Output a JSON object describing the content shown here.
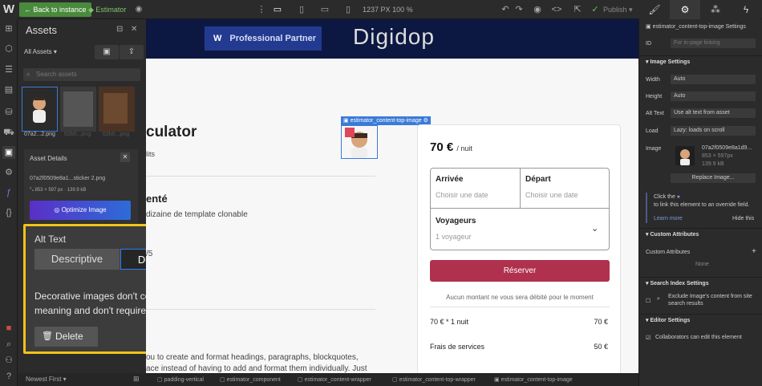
{
  "topbar": {
    "back_label": "Back to instance",
    "estimator_label": "Estimator",
    "width_readout": "1237",
    "unit_px": "PX",
    "zoom": "100",
    "zoom_unit": "%",
    "publish_label": "Publish"
  },
  "assets": {
    "title": "Assets",
    "filter_label": "All Assets",
    "search_placeholder": "Search assets",
    "thumbs": [
      "07a2...2.png",
      "62b0...png",
      "62b0...png"
    ],
    "footer_sort": "Newest First"
  },
  "asset_details": {
    "title": "Asset Details",
    "filename": "07a2f0509e8a1...sticker 2.png",
    "dimensions": "853 × 597 px",
    "filesize": "139.9 kB",
    "optimize_label": "Optimize Image"
  },
  "alt_text": {
    "title": "Alt Text",
    "descriptive_label": "Descriptive",
    "decorative_label": "Decorative",
    "description": "Decorative images don't convey meaning and don't require alt text.",
    "delete_label": "Delete"
  },
  "canvas": {
    "partner_w": "W",
    "partner_label": "Professional Partner",
    "brand": "Digidop",
    "heading": "culator",
    "sub": "lits",
    "section_heading": "enté",
    "section_text": "dizaine de template clonable",
    "fraction": "/5",
    "bottom_text_1": "ou to create and format headings, paragraphs, blockquotes,",
    "bottom_text_2": "ace instead of having to add and format them individually. Just",
    "image_tag": "estimator_content-top-image",
    "card": {
      "price": "70 €",
      "per_night": "/ nuit",
      "arrival_label": "Arrivée",
      "arrival_placeholder": "Choisir une date",
      "departure_label": "Départ",
      "departure_placeholder": "Choisir une date",
      "travelers_label": "Voyageurs",
      "travelers_value": "1 voyageur",
      "reserve_label": "Réserver",
      "note": "Aucun montant ne vous sera débité pour le moment",
      "row1_label": "70 € * 1 nuit",
      "row1_value": "70 €",
      "row2_label": "Frais de services",
      "row2_value": "50 €"
    }
  },
  "breadcrumbs": [
    "padding-vertical",
    "estimator_component",
    "estimator_content-wrapper",
    "estimator_content-top-wrapper",
    "estimator_content-top-image"
  ],
  "right_panel": {
    "element_name": "estimator_content-top-image Settings",
    "id_label": "ID",
    "id_placeholder": "For in-page linking",
    "image_settings": "Image Settings",
    "width_label": "Width",
    "width_value": "Auto",
    "height_label": "Height",
    "height_value": "Auto",
    "alt_label": "Alt Text",
    "alt_value": "Use alt text from asset",
    "load_label": "Load",
    "load_value": "Lazy: loads on scroll",
    "image_label": "Image",
    "image_file": "07a2f0509e8a1d9...",
    "image_dims": "853 × 597px",
    "image_size": "139.9 kB",
    "replace_label": "Replace Image...",
    "info_text_1": "Click the",
    "info_text_2": "to link this element to an override field.",
    "learn_more": "Learn more",
    "hide_this": "Hide this",
    "custom_attrs": "Custom Attributes",
    "custom_attrs_sub": "Custom Attributes",
    "none_label": "None",
    "search_index": "Search Index Settings",
    "exclude_text": "Exclude Image's content from site search results",
    "editor_settings": "Editor Settings",
    "collab_text": "Collaborators can edit this element"
  }
}
